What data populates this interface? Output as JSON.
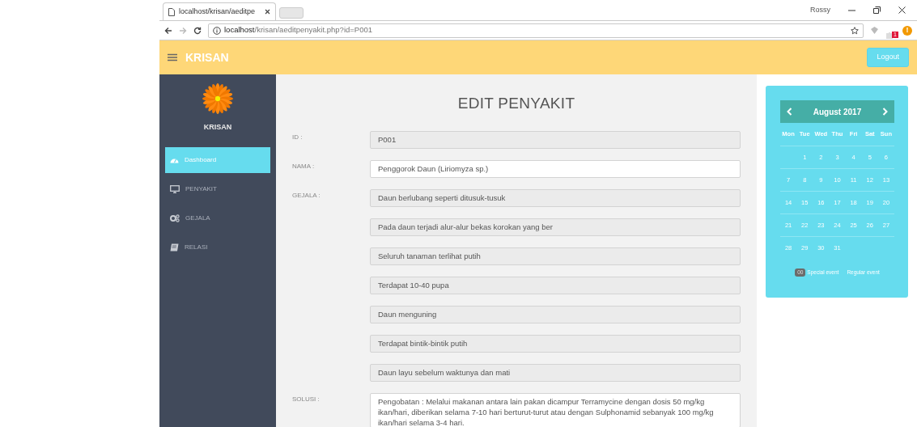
{
  "browser": {
    "tab_title": "localhost/krisan/aeditpe",
    "url_host": "localhost",
    "url_path": "/krisan/aeditpenyakit.php?id=P001",
    "profile_name": "Rossy",
    "extension_badge": "1",
    "alert_mark": "!"
  },
  "navbar": {
    "brand": "KRISAN",
    "logout": "Logout"
  },
  "sidebar": {
    "logo_text": "KRISAN",
    "items": [
      {
        "label": "Dashboard",
        "selected": true
      },
      {
        "label": "PENYAKIT",
        "selected": false
      },
      {
        "label": "GEJALA",
        "selected": false
      },
      {
        "label": "RELASI",
        "selected": false
      }
    ]
  },
  "form": {
    "title": "EDIT PENYAKIT",
    "fields": [
      {
        "label": "ID :",
        "kind": "input",
        "inputs": [
          {
            "value": "P001",
            "readonly": true
          }
        ]
      },
      {
        "label": "NAMA :",
        "kind": "input",
        "inputs": [
          {
            "value": "Penggorok Daun (Liriomyza sp.)",
            "readonly": false
          }
        ]
      },
      {
        "label": "GEJALA :",
        "kind": "input",
        "inputs": [
          {
            "value": "Daun berlubang seperti ditusuk-tusuk",
            "readonly": true
          },
          {
            "value": "Pada daun terjadi alur-alur bekas korokan yang ber",
            "readonly": true
          },
          {
            "value": "Seluruh tanaman terlihat putih",
            "readonly": true
          },
          {
            "value": "Terdapat 10-40 pupa",
            "readonly": true
          },
          {
            "value": "Daun menguning",
            "readonly": true
          },
          {
            "value": "Terdapat bintik-bintik putih",
            "readonly": true
          },
          {
            "value": "Daun layu sebelum waktunya dan mati",
            "readonly": true
          }
        ]
      },
      {
        "label": "SOLUSI :",
        "kind": "textarea",
        "inputs": [
          {
            "value": "Pengobatan : Melalui makanan antara lain pakan dicampur Terramycine dengan dosis 50 mg/kg ikan/hari, diberikan selama 7-10 hari berturut-turut atau dengan Sulphonamid sebanyak 100 mg/kg ikan/hari selama 3-4 hari.",
            "readonly": false
          }
        ]
      }
    ]
  },
  "calendar": {
    "month": "August 2017",
    "weekdays": [
      "Mon",
      "Tue",
      "Wed",
      "Thu",
      "Fri",
      "Sat",
      "Sun"
    ],
    "weeks": [
      [
        "1",
        "2",
        "3",
        "4",
        "5",
        "6"
      ],
      [
        "7",
        "8",
        "9",
        "10",
        "11",
        "12",
        "13"
      ],
      [
        "14",
        "15",
        "16",
        "17",
        "18",
        "19",
        "20"
      ],
      [
        "21",
        "22",
        "23",
        "24",
        "25",
        "26",
        "27"
      ],
      [
        "28",
        "29",
        "30",
        "31"
      ]
    ],
    "legend": [
      {
        "kind": "badge",
        "badge": "00",
        "label": "Special event"
      },
      {
        "kind": "plain",
        "label": "Regular event"
      }
    ]
  }
}
